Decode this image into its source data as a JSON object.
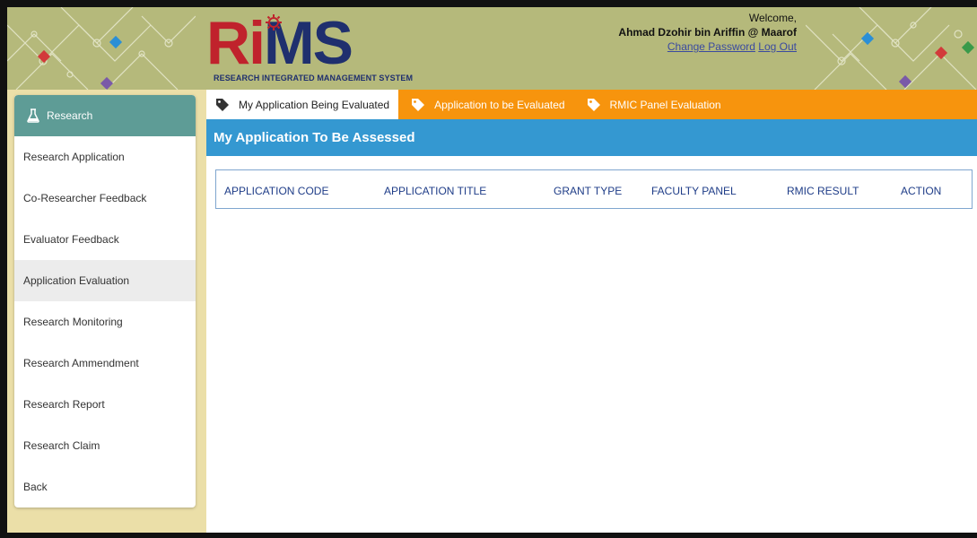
{
  "header": {
    "logo": {
      "letters": {
        "r": "R",
        "i": "i",
        "ms": "MS"
      },
      "tagline": "RESEARCH INTEGRATED MANAGEMENT SYSTEM"
    },
    "welcome": {
      "greeting": "Welcome,",
      "user_name": "Ahmad Dzohir bin Ariffin @ Maarof",
      "change_password": "Change Password",
      "logout": "Log Out"
    }
  },
  "sidebar": {
    "title": "Research",
    "items": [
      {
        "label": "Research Application",
        "active": false
      },
      {
        "label": "Co-Researcher Feedback",
        "active": false
      },
      {
        "label": "Evaluator Feedback",
        "active": false
      },
      {
        "label": "Application Evaluation",
        "active": true
      },
      {
        "label": "Research Monitoring",
        "active": false
      },
      {
        "label": "Research Ammendment",
        "active": false
      },
      {
        "label": "Research Report",
        "active": false
      },
      {
        "label": "Research Claim",
        "active": false
      },
      {
        "label": "Back",
        "active": false
      }
    ]
  },
  "tabs": [
    {
      "label": "My Application Being Evaluated",
      "active": true,
      "icon": "tag-icon"
    },
    {
      "label": "Application to be Evaluated",
      "active": false,
      "icon": "tag-icon"
    },
    {
      "label": "RMIC Panel Evaluation",
      "active": false,
      "icon": "tag-icon"
    }
  ],
  "content": {
    "title": "My Application To Be Assessed",
    "table": {
      "columns": [
        "APPLICATION CODE",
        "APPLICATION TITLE",
        "GRANT TYPE",
        "FACULTY PANEL",
        "RMIC RESULT",
        "ACTION"
      ],
      "rows": []
    }
  },
  "colors": {
    "header_bg": "#b5b97b",
    "sidebar_bg": "#ebdfa8",
    "sidebar_head": "#5e9c96",
    "tab_bar": "#f7940d",
    "title_bar": "#3498d1",
    "table_header_text": "#1f3d88"
  }
}
